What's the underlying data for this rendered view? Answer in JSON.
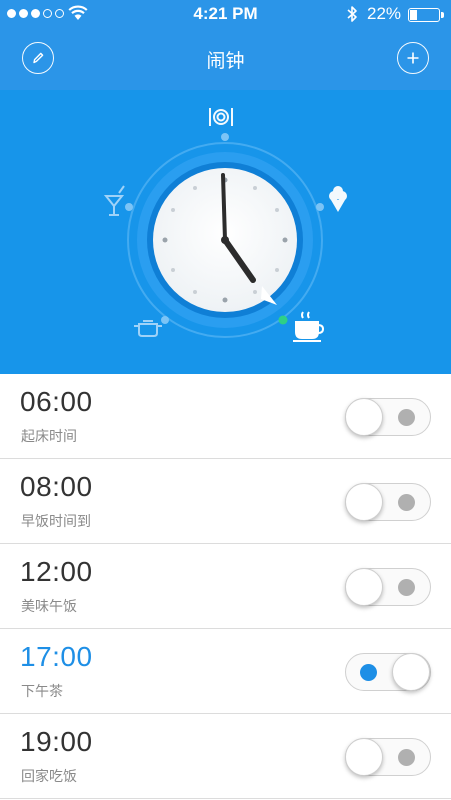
{
  "status_bar": {
    "time": "4:21 PM",
    "battery": "22%",
    "signal_bars_filled": 3,
    "signal_bars_total": 5
  },
  "nav": {
    "title": "闹钟",
    "left_icon": "pencil-icon",
    "right_icon": "plus-icon"
  },
  "clock": {
    "time_shown": "4:00",
    "meal_icons": [
      "dining-icon",
      "dessert-icon",
      "coffee-icon",
      "cooking-pot-icon",
      "drink-icon"
    ],
    "active_marker_color": "#2ed087"
  },
  "colors": {
    "primary": "#2b95e8",
    "panel": "#1795ea",
    "active_text": "#1e8fe6"
  },
  "alarms": [
    {
      "time": "06:00",
      "label": "起床时间",
      "enabled": false
    },
    {
      "time": "08:00",
      "label": "早饭时间到",
      "enabled": false
    },
    {
      "time": "12:00",
      "label": "美味午饭",
      "enabled": false
    },
    {
      "time": "17:00",
      "label": "下午茶",
      "enabled": true
    },
    {
      "time": "19:00",
      "label": "回家吃饭",
      "enabled": false
    }
  ]
}
